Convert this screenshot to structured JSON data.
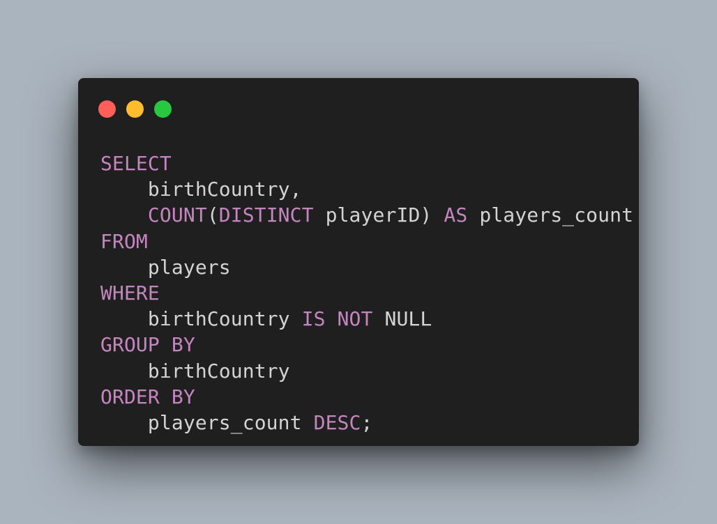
{
  "theme": {
    "background": "#aab4be",
    "window_bg": "#1f1f1f",
    "keyword": "#c586c0",
    "identifier": "#d4d4d4",
    "punctuation": "#d4d4d4"
  },
  "window_controls": [
    {
      "name": "close",
      "color": "#ff5f57"
    },
    {
      "name": "minimize",
      "color": "#febc2e"
    },
    {
      "name": "maximize",
      "color": "#28c840"
    }
  ],
  "code": {
    "language": "sql",
    "lines": [
      [
        {
          "t": "SELECT",
          "k": "kw"
        }
      ],
      [
        {
          "t": "    birthCountry",
          "k": "id"
        },
        {
          "t": ",",
          "k": "pu"
        }
      ],
      [
        {
          "t": "    ",
          "k": "id"
        },
        {
          "t": "COUNT",
          "k": "kw"
        },
        {
          "t": "(",
          "k": "pu"
        },
        {
          "t": "DISTINCT",
          "k": "kw"
        },
        {
          "t": " playerID",
          "k": "id"
        },
        {
          "t": ")",
          "k": "pu"
        },
        {
          "t": " ",
          "k": "id"
        },
        {
          "t": "AS",
          "k": "kw"
        },
        {
          "t": " players_count",
          "k": "id"
        }
      ],
      [
        {
          "t": "FROM",
          "k": "kw"
        }
      ],
      [
        {
          "t": "    players",
          "k": "id"
        }
      ],
      [
        {
          "t": "WHERE",
          "k": "kw"
        }
      ],
      [
        {
          "t": "    birthCountry ",
          "k": "id"
        },
        {
          "t": "IS NOT",
          "k": "kw"
        },
        {
          "t": " NULL",
          "k": "id"
        }
      ],
      [
        {
          "t": "GROUP BY",
          "k": "kw"
        }
      ],
      [
        {
          "t": "    birthCountry",
          "k": "id"
        }
      ],
      [
        {
          "t": "ORDER BY",
          "k": "kw"
        }
      ],
      [
        {
          "t": "    players_count ",
          "k": "id"
        },
        {
          "t": "DESC",
          "k": "kw"
        },
        {
          "t": ";",
          "k": "pu"
        }
      ]
    ]
  }
}
